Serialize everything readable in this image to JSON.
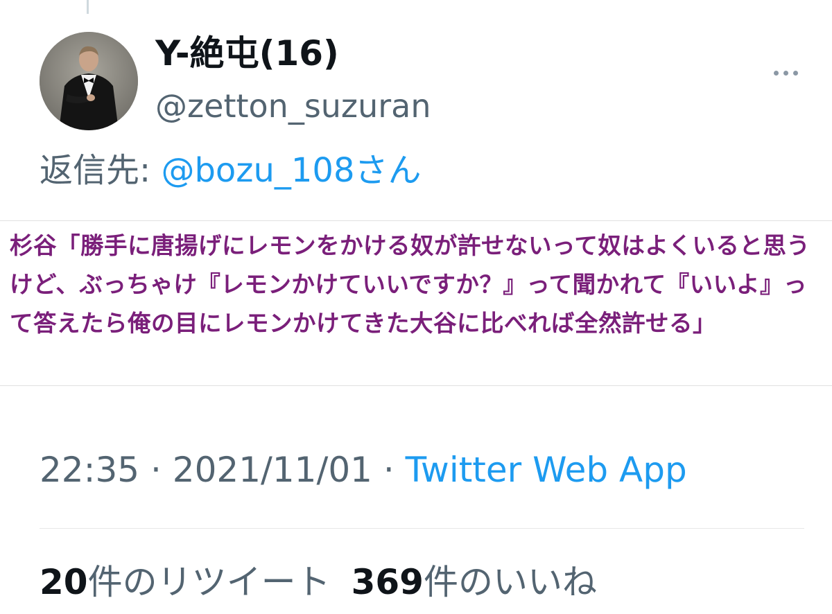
{
  "tweet": {
    "author": {
      "display_name": "Y-絶屯(16)",
      "handle": "@zetton_suzuran",
      "avatar_icon": "profile-photo"
    },
    "more_icon": "more-horizontal-icon",
    "reply": {
      "prefix": "返信先: ",
      "target": "@bozu_108さん"
    },
    "text": "杉谷「勝手に唐揚げにレモンをかける奴が許せないって奴はよくいると思うけど、ぶっちゃけ『レモンかけていいですか？』って聞かれて『いいよ』って答えたら俺の目にレモンかけてきた大谷に比べれば全然許せる」",
    "text_color": "#7a1f7a",
    "time": "22:35",
    "separator": " · ",
    "date": "2021/11/01",
    "source": "Twitter Web App",
    "retweets": {
      "count": "20",
      "label": "件のリツイート"
    },
    "likes": {
      "count": "369",
      "label": "件のいいね"
    }
  },
  "colors": {
    "link": "#1d9bf0",
    "secondary_text": "#536471",
    "primary_text": "#0f1419"
  }
}
